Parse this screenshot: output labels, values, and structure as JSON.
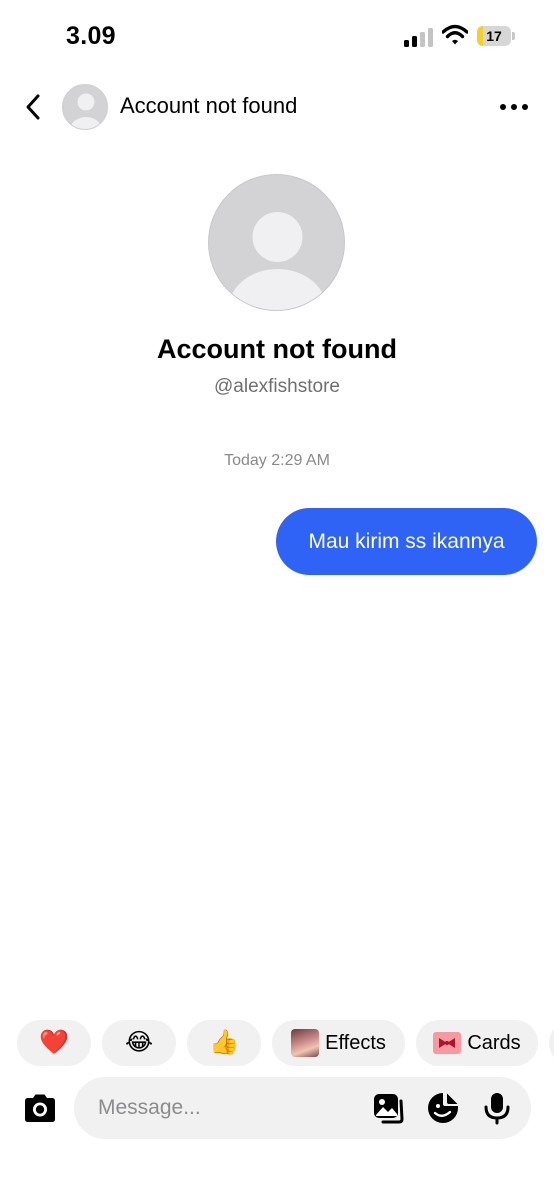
{
  "status_bar": {
    "time": "3.09",
    "battery_level": "17",
    "battery_fraction": 0.17,
    "battery_color": "#f5cf2a",
    "icons": [
      "signal-icon",
      "wifi-icon",
      "battery-icon"
    ]
  },
  "header": {
    "title": "Account not found",
    "back_icon": "chevron-left-icon",
    "more_icon": "more-horizontal-icon"
  },
  "profile": {
    "name": "Account not found",
    "handle": "@alexfishstore"
  },
  "conversation": {
    "timestamp": "Today 2:29 AM",
    "messages": [
      {
        "text": "Mau kirim ss ikannya",
        "sender": "self",
        "bubble_color": "#2f63f5"
      }
    ]
  },
  "quick_reactions": [
    {
      "emoji": "❤️",
      "name": "heart"
    },
    {
      "emoji": "😂",
      "name": "laughing"
    },
    {
      "emoji": "👍",
      "name": "thumbs-up"
    }
  ],
  "quick_actions": {
    "effects_label": "Effects",
    "cards_label": "Cards"
  },
  "composer": {
    "placeholder": "Message...",
    "icons": [
      "camera-icon",
      "image-icon",
      "sticker-icon",
      "microphone-icon"
    ]
  }
}
